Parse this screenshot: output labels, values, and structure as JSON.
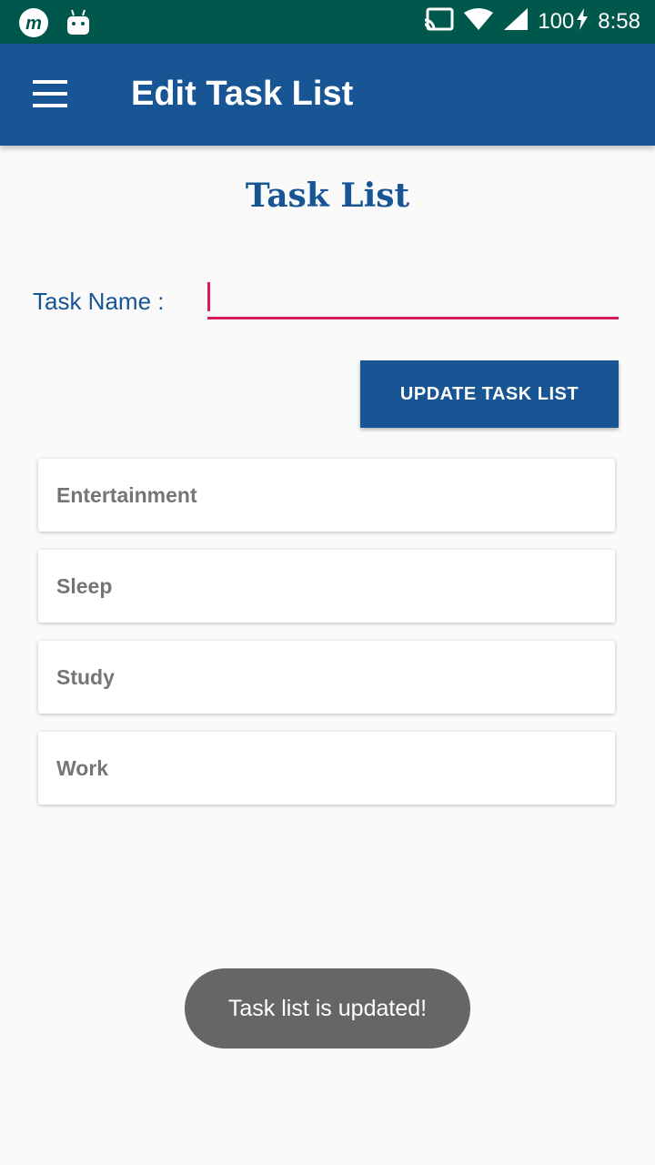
{
  "status_bar": {
    "notification_icons": [
      "m-app-icon",
      "android-icon"
    ],
    "indicator_icons": [
      "cast-icon",
      "wifi-icon",
      "signal-icon"
    ],
    "battery": "100",
    "battery_icon": "charging-bolt-icon",
    "time": "8:58"
  },
  "app_bar": {
    "menu_icon": "hamburger-menu-icon",
    "title": "Edit Task List"
  },
  "main": {
    "section_title": "Task List",
    "field_label": "Task Name :",
    "field_value": "",
    "update_button": "UPDATE TASK LIST",
    "items": [
      {
        "label": "Entertainment"
      },
      {
        "label": "Sleep"
      },
      {
        "label": "Study"
      },
      {
        "label": "Work"
      }
    ]
  },
  "toast": {
    "message": "Task list is updated!"
  },
  "colors": {
    "status_bar": "#00574b",
    "app_bar": "#175594",
    "accent": "#d81b60",
    "item_text": "#757575",
    "toast_bg": "#666666"
  }
}
